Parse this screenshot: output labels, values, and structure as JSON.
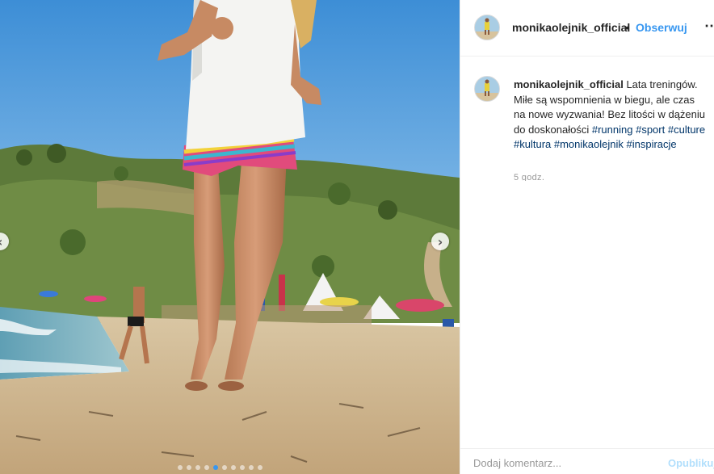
{
  "post": {
    "username": "monikaolejnik_official",
    "follow_label": "Obserwuj",
    "separator": "•",
    "more_icon": "more-options-icon",
    "caption_text": "Lata treningów. Miłe są wspomnienia w biegu, ale czas na nowe wyzwania! Bez litości w dążeniu do doskonałości",
    "hashtags": [
      "#running",
      "#sport",
      "#culture",
      "#kultura",
      "#monikaolejnik",
      "#inspiracje"
    ],
    "time_ago": "5 godz."
  },
  "carousel": {
    "slide_count": 10,
    "active_index": 4,
    "next_icon": "chevron-right-icon",
    "prev_icon": "chevron-left-icon"
  },
  "composer": {
    "placeholder": "Dodaj komentarz...",
    "publish_label": "Opublikuj"
  },
  "colors": {
    "link": "#3897f0",
    "hashtag": "#003569",
    "publish_disabled": "#b2dffc"
  }
}
